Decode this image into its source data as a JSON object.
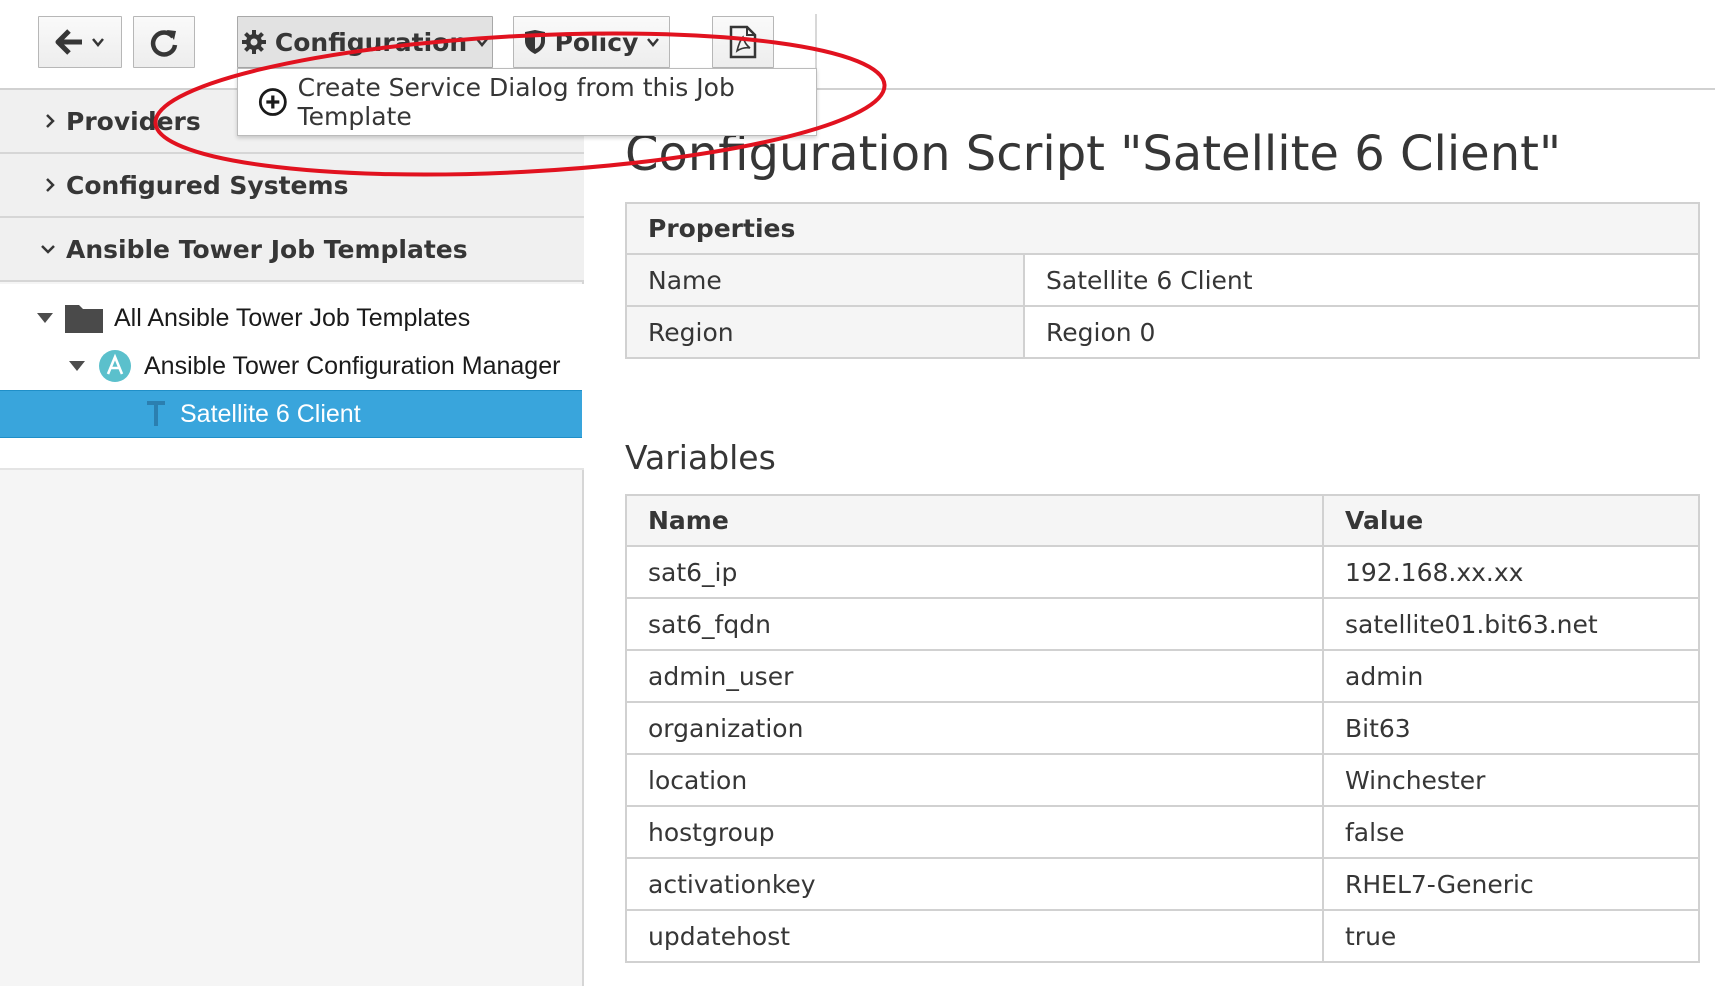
{
  "toolbar": {
    "configuration_label": "Configuration",
    "policy_label": "Policy"
  },
  "dropdown": {
    "create_service_dialog_label": "Create Service Dialog from this Job Template"
  },
  "sidebar": {
    "accordions": [
      "Providers",
      "Configured Systems",
      "Ansible Tower Job Templates"
    ],
    "tree": {
      "root": "All Ansible Tower Job Templates",
      "manager": "Ansible Tower Configuration Manager",
      "selected": "Satellite 6 Client"
    }
  },
  "main": {
    "title": "Configuration Script \"Satellite 6 Client\"",
    "properties": {
      "header": "Properties",
      "rows": [
        {
          "label": "Name",
          "value": "Satellite 6 Client"
        },
        {
          "label": "Region",
          "value": "Region 0"
        }
      ]
    },
    "variables": {
      "title": "Variables",
      "columns": [
        "Name",
        "Value"
      ],
      "rows": [
        {
          "name": "sat6_ip",
          "value": "192.168.xx.xx"
        },
        {
          "name": "sat6_fqdn",
          "value": "satellite01.bit63.net"
        },
        {
          "name": "admin_user",
          "value": "admin"
        },
        {
          "name": "organization",
          "value": "Bit63"
        },
        {
          "name": "location",
          "value": "Winchester"
        },
        {
          "name": "hostgroup",
          "value": "false"
        },
        {
          "name": "activationkey",
          "value": "RHEL7-Generic"
        },
        {
          "name": "updatehost",
          "value": "true"
        }
      ]
    }
  },
  "colors": {
    "selected_bg": "#39a5dc",
    "annotation": "#e1121f"
  },
  "icons": [
    "back-arrow-icon",
    "refresh-icon",
    "gear-icon",
    "shield-icon",
    "pdf-icon",
    "plus-circle-icon",
    "folder-icon",
    "ansible-icon",
    "template-icon"
  ]
}
